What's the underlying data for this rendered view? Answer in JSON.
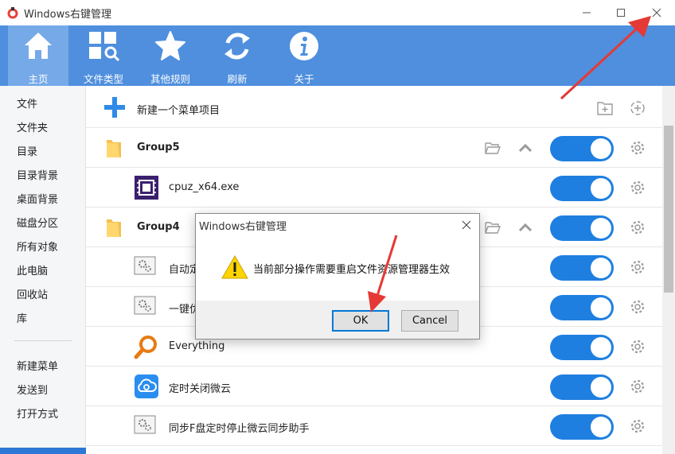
{
  "window": {
    "title": "Windows右键管理",
    "minimize_icon": "minimize-icon",
    "maximize_icon": "maximize-icon",
    "close_icon": "close-icon"
  },
  "toolbar": {
    "items": [
      {
        "label": "主页",
        "icon": "home-icon",
        "active": true
      },
      {
        "label": "文件类型",
        "icon": "file-type-search-icon",
        "active": false
      },
      {
        "label": "其他规则",
        "icon": "star-icon",
        "active": false
      },
      {
        "label": "刷新",
        "icon": "refresh-icon",
        "active": false
      },
      {
        "label": "关于",
        "icon": "info-icon",
        "active": false
      }
    ]
  },
  "sidebar": {
    "items": [
      "文件",
      "文件夹",
      "目录",
      "目录背景",
      "桌面背景",
      "磁盘分区",
      "所有对象",
      "此电脑",
      "回收站",
      "库"
    ],
    "items2": [
      "新建菜单",
      "发送到",
      "打开方式"
    ]
  },
  "main": {
    "new_item_label": "新建一个菜单项目",
    "rows": [
      {
        "label": "Group5",
        "type": "group",
        "enabled": true
      },
      {
        "label": "cpuz_x64.exe",
        "type": "item",
        "enabled": true
      },
      {
        "label": "Group4",
        "type": "group",
        "enabled": true
      },
      {
        "label": "自动定",
        "type": "item",
        "enabled": true
      },
      {
        "label": "一键优",
        "type": "item",
        "enabled": true
      },
      {
        "label": "Everything",
        "type": "item",
        "enabled": true
      },
      {
        "label": "定时关闭微云",
        "type": "item",
        "enabled": true
      },
      {
        "label": "同步F盘定时停止微云同步助手",
        "type": "item",
        "enabled": true
      }
    ]
  },
  "dialog": {
    "title": "Windows右键管理",
    "message": "当前部分操作需要重启文件资源管理器生效",
    "ok_label": "OK",
    "cancel_label": "Cancel",
    "icon": "warning-icon"
  },
  "colors": {
    "toolbar": "#4f8fde",
    "toggle_on": "#1f7fe0",
    "annotation_arrow": "#e53935"
  }
}
